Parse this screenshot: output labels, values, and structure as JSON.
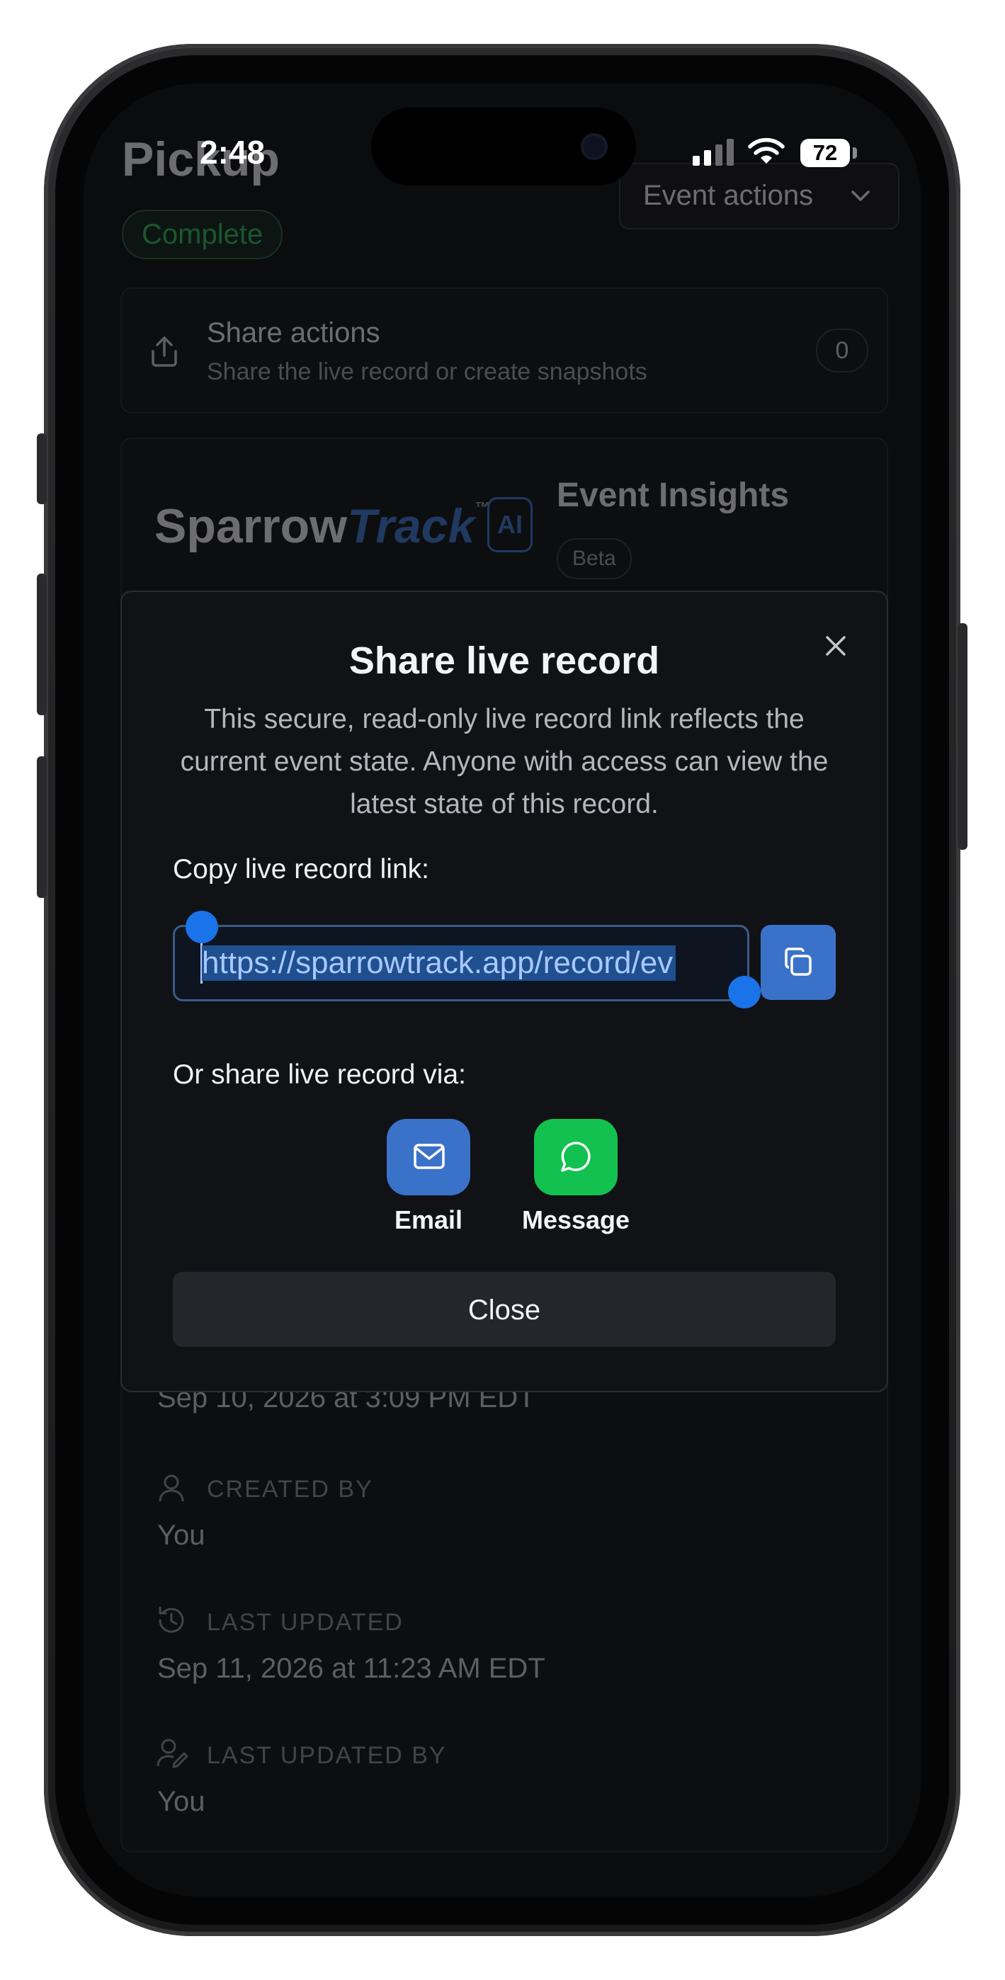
{
  "status_bar": {
    "time": "2:48",
    "battery": "72"
  },
  "app": {
    "title": "Pickup",
    "status_badge": "Complete",
    "event_actions_label": "Event actions"
  },
  "share_actions": {
    "title": "Share actions",
    "subtitle": "Share the live record or create snapshots",
    "count": "0"
  },
  "insights": {
    "brand_left": "Sparrow",
    "brand_right": "Track",
    "brand_tm": "™",
    "brand_ai": "AI",
    "title": "Event Insights",
    "badge": "Beta"
  },
  "modal": {
    "title": "Share live record",
    "description": "This secure, read-only live record link reflects the current event state. Anyone with access can view the latest state of this record.",
    "copy_label": "Copy live record link:",
    "link_value": "https://sparrowtrack.app/record/ev",
    "share_via_label": "Or share live record via:",
    "email_label": "Email",
    "message_label": "Message",
    "close_label": "Close"
  },
  "details": {
    "created_at_value": "Sep 10, 2026 at 3:09 PM EDT",
    "created_by_label": "CREATED BY",
    "created_by_value": "You",
    "last_updated_label": "LAST UPDATED",
    "last_updated_value": "Sep 11, 2026 at 11:23 AM EDT",
    "last_updated_by_label": "LAST UPDATED BY",
    "last_updated_by_value": "You"
  },
  "colors": {
    "accent": "#3b72c9",
    "message_green": "#12c14f",
    "complete_green": "#2fb35a",
    "background": "#0b0c0e"
  }
}
